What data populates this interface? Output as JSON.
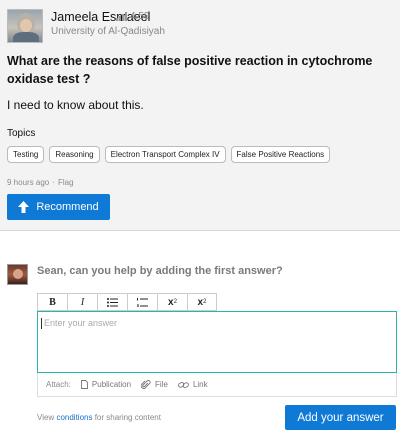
{
  "author": {
    "name": "Jameela Esmaeel",
    "score": "4.59",
    "institution": "University of Al-Qadisiyah"
  },
  "question": {
    "title": "What are the reasons of false positive reaction in cytochrome oxidase test ?",
    "body": "I need to know about this.",
    "topics_heading": "Topics",
    "topics": [
      "Testing",
      "Reasoning",
      "Electron Transport Complex IV",
      "False Positive Reactions"
    ],
    "time_ago": "9 hours ago",
    "separator": "·",
    "flag_label": "Flag"
  },
  "recommend_label": "Recommend",
  "answer": {
    "prompt": "Sean, can you help by adding the first answer?",
    "toolbar": {
      "bold": "B",
      "italic": "I",
      "subscript_base": "x",
      "subscript_mark": "2",
      "superscript_base": "x",
      "superscript_mark": "2"
    },
    "placeholder": "Enter your answer",
    "attach_label": "Attach:",
    "attach_publication": "Publication",
    "attach_file": "File",
    "attach_link": "Link",
    "conditions_prefix": "View",
    "conditions_link": "conditions",
    "conditions_suffix": "for sharing content",
    "submit_label": "Add your answer"
  },
  "colors": {
    "accent_blue": "#0f7ad6",
    "input_border_teal": "#2cb3aa",
    "card_background": "#f3f3f3"
  }
}
